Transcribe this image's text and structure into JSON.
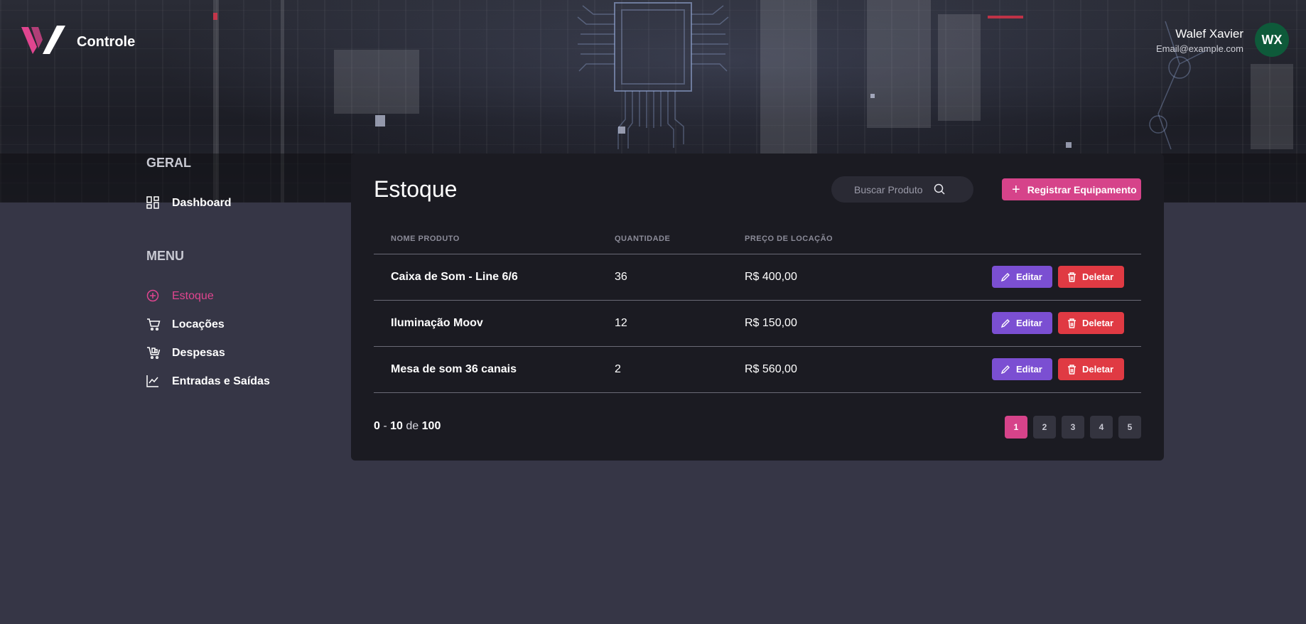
{
  "brand": {
    "name": "Controle"
  },
  "user": {
    "name": "Walef Xavier",
    "email": "Email@example.com",
    "initials": "WX"
  },
  "sidebar": {
    "geral_heading": "GERAL",
    "menu_heading": "MENU",
    "items": [
      {
        "label": "Dashboard",
        "icon": "dashboard-icon"
      },
      {
        "label": "Estoque",
        "icon": "plus-circle-icon",
        "active": true
      },
      {
        "label": "Locações",
        "icon": "cart-icon"
      },
      {
        "label": "Despesas",
        "icon": "cart-stack-icon"
      },
      {
        "label": "Entradas e Saídas",
        "icon": "chart-line-icon"
      }
    ]
  },
  "main": {
    "title": "Estoque",
    "search_placeholder": "Buscar Produto",
    "register_label": "Registrar Equipamento",
    "columns": [
      "NOME PRODUTO",
      "QUANTIDADE",
      "PREÇO DE LOCAÇÃO"
    ],
    "rows": [
      {
        "name": "Caixa de Som - Line 6/6",
        "quantity": "36",
        "price": "R$ 400,00"
      },
      {
        "name": "Iluminação Moov",
        "quantity": "12",
        "price": "R$ 150,00"
      },
      {
        "name": "Mesa de som 36 canais",
        "quantity": "2",
        "price": "R$ 560,00"
      }
    ],
    "edit_label": "Editar",
    "delete_label": "Deletar",
    "pagination": {
      "from": "0",
      "separator": "-",
      "to": "10",
      "of": "de",
      "total": "100",
      "pages": [
        "1",
        "2",
        "3",
        "4",
        "5"
      ],
      "current_page": "1"
    }
  },
  "colors": {
    "accent": "#d6438a",
    "edit": "#7b4fd2",
    "delete": "#e03a43",
    "background": "#363646",
    "card": "#1b1b22"
  }
}
